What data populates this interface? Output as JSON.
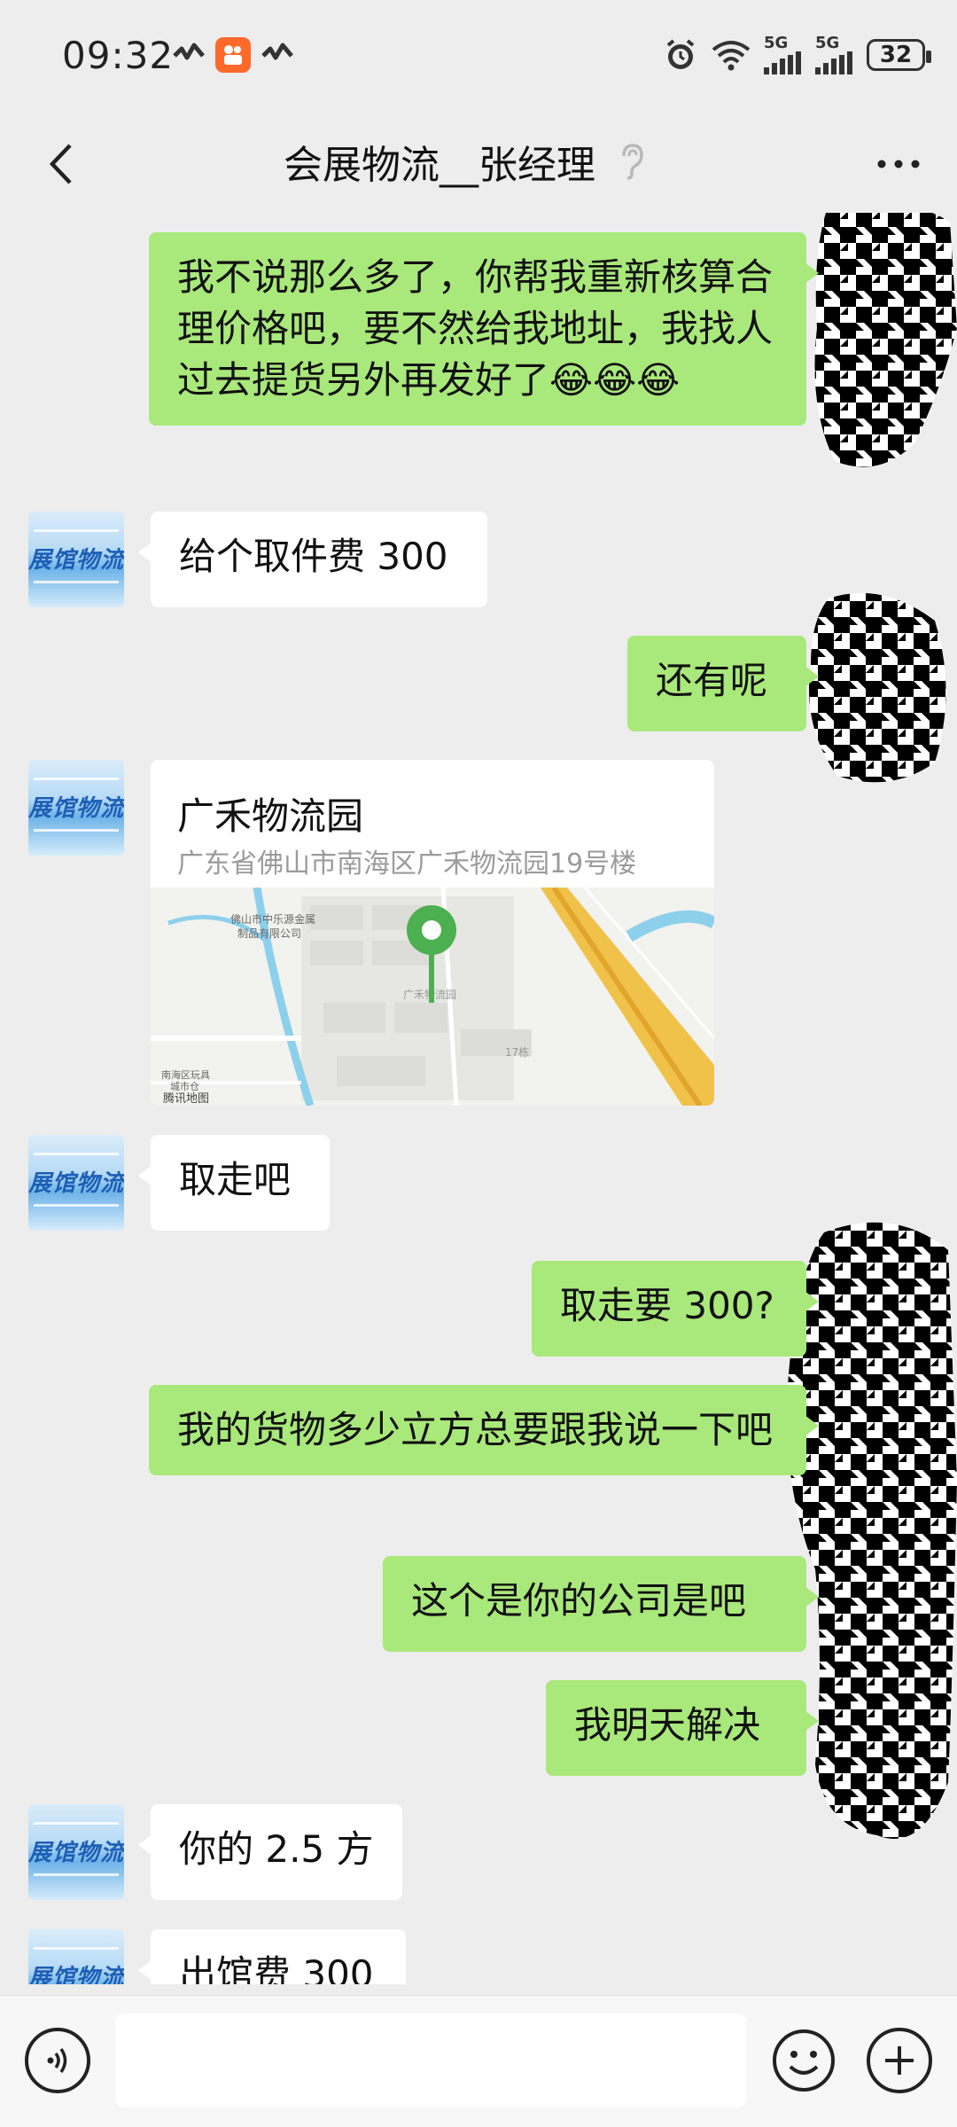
{
  "status": {
    "time": "09:32",
    "network_1": "5G",
    "network_2": "5G",
    "battery": "32"
  },
  "header": {
    "title": "会展物流__张经理"
  },
  "contact": {
    "avatar_text": "展馆物流"
  },
  "messages": [
    {
      "from": "me",
      "text": "我不说那么多了，你帮我重新核算合理价格吧，要不然给我地址，我找人过去提货另外再发好了😂😂😂"
    },
    {
      "from": "them",
      "text": "给个取件费 300"
    },
    {
      "from": "me",
      "text": "还有呢"
    },
    {
      "from": "them",
      "type": "location",
      "title": "广禾物流园",
      "address": "广东省佛山市南海区广禾物流园19号楼",
      "map_labels": [
        "佛山市中乐源金属制品有限公司",
        "广禾物流园",
        "17栋",
        "南海区玩具城市仓",
        "腾讯地图"
      ]
    },
    {
      "from": "them",
      "text": "取走吧"
    },
    {
      "from": "me",
      "text": "取走要 300?"
    },
    {
      "from": "me",
      "text": "我的货物多少立方总要跟我说一下吧"
    },
    {
      "from": "me",
      "text": "这个是你的公司是吧"
    },
    {
      "from": "me",
      "text": "我明天解决"
    },
    {
      "from": "them",
      "text": "你的 2.5 方"
    },
    {
      "from": "them",
      "text": "出馆费 300"
    }
  ],
  "input": {
    "placeholder": ""
  }
}
